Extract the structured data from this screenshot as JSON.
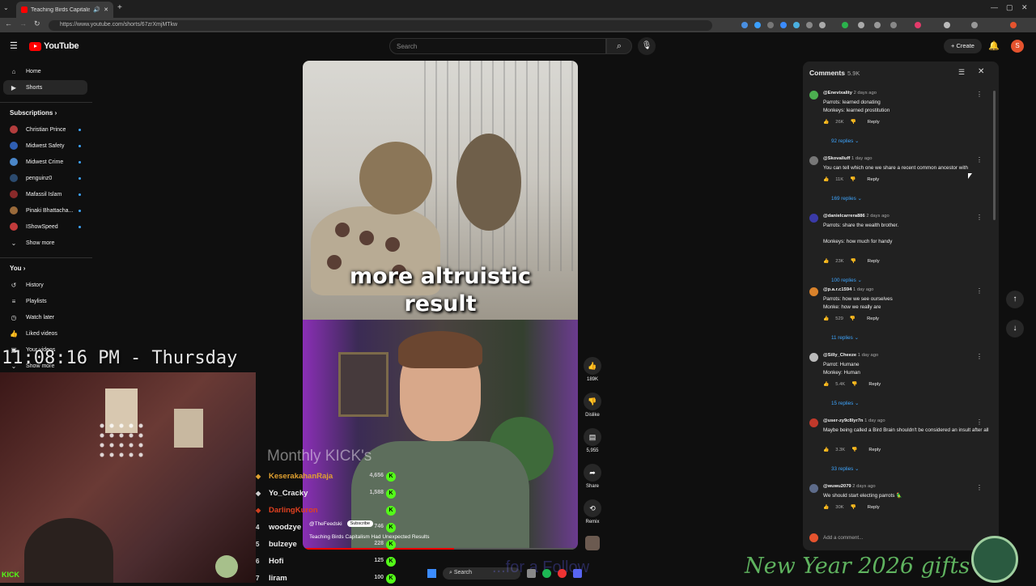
{
  "browser": {
    "tab_title": "Teaching Birds Capitalism I",
    "url": "https://www.youtube.com/shorts/67zrXmjMTkw",
    "new_tab_icon": "plus-icon",
    "window_controls": [
      "—",
      "▢",
      "✕"
    ]
  },
  "header": {
    "logo_text": "YouTube",
    "search_placeholder": "Search",
    "create_label": "Create",
    "avatar_letter": "S"
  },
  "sidebar": {
    "items": [
      {
        "label": "Home",
        "icon": "home-icon"
      },
      {
        "label": "Shorts",
        "icon": "shorts-icon"
      }
    ],
    "subscriptions_title": "Subscriptions",
    "subscriptions": [
      {
        "label": "Christian Prince",
        "color": "#b33d3d"
      },
      {
        "label": "Midwest Safety",
        "color": "#2f5fb3"
      },
      {
        "label": "Midwest Crime",
        "color": "#4a86c8"
      },
      {
        "label": "penguinz0",
        "color": "#2b4a6e"
      },
      {
        "label": "Mafassil Islam",
        "color": "#8a2a2a"
      },
      {
        "label": "Pinaki Bhattacha...",
        "color": "#9a6a3a"
      },
      {
        "label": "IShowSpeed",
        "color": "#c23b3b"
      }
    ],
    "show_more": "Show more",
    "you_title": "You",
    "you_items": [
      {
        "label": "History",
        "icon": "history-icon"
      },
      {
        "label": "Playlists",
        "icon": "playlists-icon"
      },
      {
        "label": "Watch later",
        "icon": "clock-icon"
      },
      {
        "label": "Liked videos",
        "icon": "like-icon"
      },
      {
        "label": "Your videos",
        "icon": "video-icon"
      },
      {
        "label": "Show more",
        "icon": "chevron-down-icon"
      }
    ]
  },
  "video": {
    "caption_line1": "more altruistic",
    "caption_line2": "result",
    "channel": "@TheFeedski",
    "subscribe_label": "Subscribe",
    "title": "Teaching Birds Capitalism Had Unexpected Results",
    "progress_fraction": 0.55
  },
  "actions": {
    "like_count": "189K",
    "dislike_label": "Dislike",
    "comment_count": "5,955",
    "share_label": "Share",
    "remix_label": "Remix"
  },
  "comments": {
    "title": "Comments",
    "count": "5.9K",
    "add_placeholder": "Add a comment...",
    "reply_label": "Reply",
    "items": [
      {
        "author": "@Enevixality",
        "time": "2 days ago",
        "text": "Parrots: learned donating\nMonkeys: learned prostitution",
        "likes": "26K",
        "replies": "92 replies",
        "avatar_color": "#4caf50"
      },
      {
        "author": "@Skovalluff",
        "time": "1 day ago",
        "text": "You can tell which one we share a recent common ancestor with",
        "likes": "11K",
        "replies": "169 replies",
        "avatar_color": "#777777"
      },
      {
        "author": "@danielcarrera886",
        "time": "2 days ago",
        "text": "Parrots: share the wealth brother.\n\nMonkeys: how much for handy",
        "likes": "23K",
        "replies": "100 replies",
        "avatar_color": "#3a3aa8"
      },
      {
        "author": "@p.a.r.c1594",
        "time": "1 day ago",
        "text": "Parrots: how we see ourselves\nMonke: how we really are",
        "likes": "529",
        "replies": "11 replies",
        "avatar_color": "#d9822b"
      },
      {
        "author": "@Silly_Cheeze",
        "time": "1 day ago",
        "text": "Parrot: Humane\nMonkey: Human",
        "likes": "5.4K",
        "replies": "15 replies",
        "avatar_color": "#bbbbbb"
      },
      {
        "author": "@user-zy9c8lyr7n",
        "time": "1 day ago",
        "text": "Maybe being called a Bird Brain shouldn't be considered an insult after all",
        "likes": "3.3K",
        "replies": "33 replies",
        "avatar_color": "#c0392b"
      },
      {
        "author": "@wuwu2079",
        "time": "2 days ago",
        "text": "We should start electing parrots 🦜",
        "likes": "30K",
        "replies": "",
        "avatar_color": "#5d6b8a"
      }
    ]
  },
  "overlay": {
    "clock": "11:08:16 PM - Thursday",
    "leaderboard_title": "Monthly KICK's",
    "leaderboard": [
      {
        "rank": "",
        "name": "KeserakahanRaja",
        "score": "4,656"
      },
      {
        "rank": "",
        "name": "Yo_Cracky",
        "score": "1,588"
      },
      {
        "rank": "",
        "name": "DarlingKuron",
        "score": ""
      },
      {
        "rank": "4",
        "name": "woodzye",
        "score": "746"
      },
      {
        "rank": "5",
        "name": "bulzeye",
        "score": "228"
      },
      {
        "rank": "6",
        "name": "Hofi",
        "score": "125"
      },
      {
        "rank": "7",
        "name": "liram",
        "score": "100"
      }
    ],
    "kick_label": "KICK",
    "new_year_text": "New Year 2026 gifts -",
    "follow_text": "...for a Follow"
  },
  "taskbar": {
    "search_label": "Search"
  }
}
